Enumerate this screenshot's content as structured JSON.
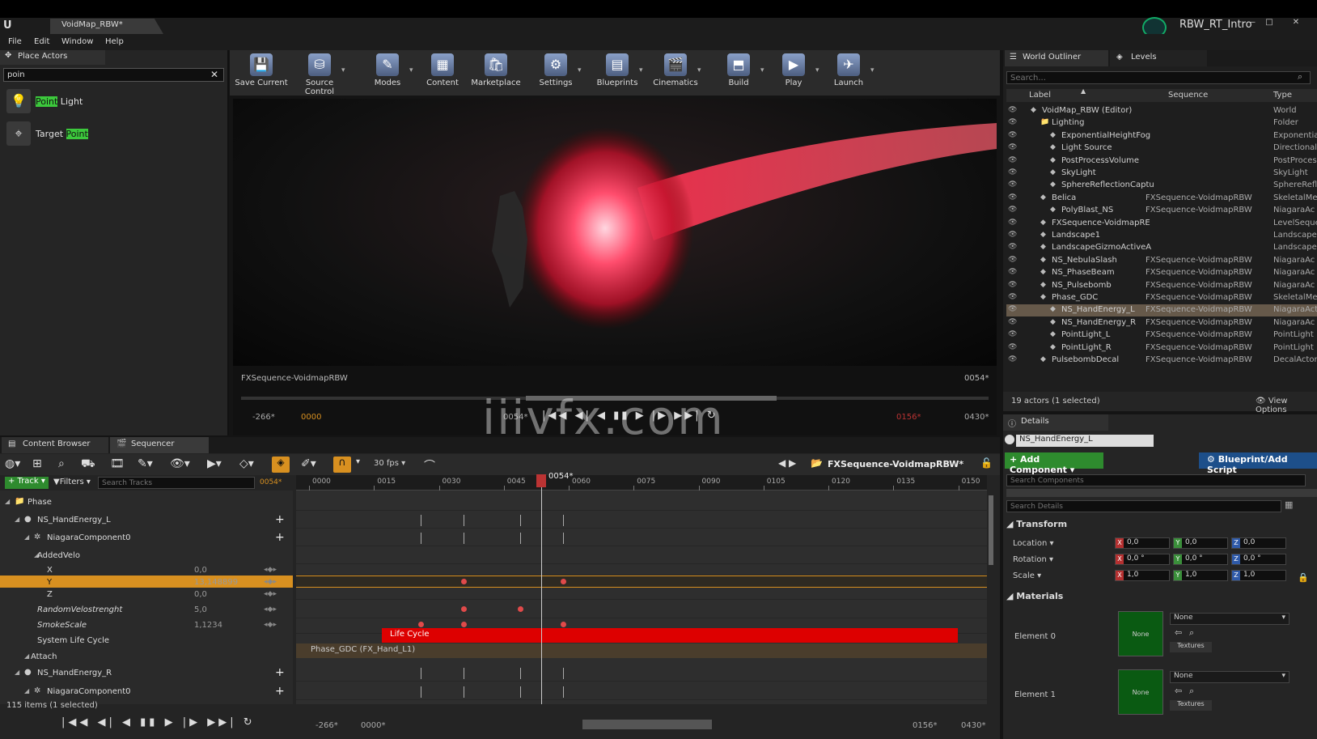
{
  "window": {
    "doc_tab": "VoidMap_RBW*",
    "project": "RBW_RT_Intro",
    "logo": "U"
  },
  "menu": [
    "File",
    "Edit",
    "Window",
    "Help"
  ],
  "place_actors": {
    "title": "Place Actors",
    "search_value": "poin",
    "items": [
      {
        "pre": "",
        "hl": "Point",
        "post": " Light",
        "icon": "bulb-icon"
      },
      {
        "pre": "Target ",
        "hl": "Point",
        "post": "",
        "icon": "target-icon"
      }
    ]
  },
  "toolbar": [
    {
      "label": "Save Current",
      "icon": "save-icon",
      "glyph": "💾"
    },
    {
      "label": "Source Control",
      "icon": "source-control-icon",
      "glyph": "⛁"
    },
    {
      "label": "Modes",
      "icon": "modes-icon",
      "glyph": "✎"
    },
    {
      "label": "Content",
      "icon": "content-icon",
      "glyph": "▦"
    },
    {
      "label": "Marketplace",
      "icon": "marketplace-icon",
      "glyph": "🛍"
    },
    {
      "label": "Settings",
      "icon": "settings-icon",
      "glyph": "⚙"
    },
    {
      "label": "Blueprints",
      "icon": "blueprints-icon",
      "glyph": "▤"
    },
    {
      "label": "Cinematics",
      "icon": "cinematics-icon",
      "glyph": "🎬"
    },
    {
      "label": "Build",
      "icon": "build-icon",
      "glyph": "⬒"
    },
    {
      "label": "Play",
      "icon": "play-icon",
      "glyph": "▶"
    },
    {
      "label": "Launch",
      "icon": "launch-icon",
      "glyph": "✈"
    }
  ],
  "viewport": {
    "sequence": "FXSequence-VoidmapRBW",
    "frame": "0054*",
    "range_start": "-266*",
    "start": "0000",
    "cur": "0054*",
    "end_red": "0156*",
    "end": "0430*",
    "watermark": "iiivfx.com"
  },
  "outliner": {
    "tabs": [
      "World Outliner",
      "Levels"
    ],
    "search_placeholder": "Search...",
    "columns": {
      "label": "Label",
      "sequence": "Sequence",
      "type": "Type"
    },
    "rows": [
      {
        "label": "VoidMap_RBW (Editor)",
        "seq": "",
        "type": "World",
        "indent": 0,
        "sel": false
      },
      {
        "label": "Lighting",
        "seq": "",
        "type": "Folder",
        "indent": 1,
        "sel": false
      },
      {
        "label": "ExponentialHeightFog",
        "seq": "",
        "type": "Exponentia",
        "indent": 2,
        "sel": false
      },
      {
        "label": "Light Source",
        "seq": "",
        "type": "Directional",
        "indent": 2,
        "sel": false
      },
      {
        "label": "PostProcessVolume",
        "seq": "",
        "type": "PostProces",
        "indent": 2,
        "sel": false
      },
      {
        "label": "SkyLight",
        "seq": "",
        "type": "SkyLight",
        "indent": 2,
        "sel": false
      },
      {
        "label": "SphereReflectionCaptu",
        "seq": "",
        "type": "SphereRefl",
        "indent": 2,
        "sel": false
      },
      {
        "label": "Belica",
        "seq": "FXSequence-VoidmapRBW",
        "type": "SkeletalMe",
        "indent": 1,
        "sel": false
      },
      {
        "label": "PolyBlast_NS",
        "seq": "FXSequence-VoidmapRBW",
        "type": "NiagaraAc",
        "indent": 2,
        "sel": false
      },
      {
        "label": "FXSequence-VoidmapRE",
        "seq": "",
        "type": "LevelSeque",
        "indent": 1,
        "sel": false
      },
      {
        "label": "Landscape1",
        "seq": "",
        "type": "Landscape",
        "indent": 1,
        "sel": false
      },
      {
        "label": "LandscapeGizmoActiveA",
        "seq": "",
        "type": "Landscape",
        "indent": 1,
        "sel": false
      },
      {
        "label": "NS_NebulaSlash",
        "seq": "FXSequence-VoidmapRBW",
        "type": "NiagaraAc",
        "indent": 1,
        "sel": false
      },
      {
        "label": "NS_PhaseBeam",
        "seq": "FXSequence-VoidmapRBW",
        "type": "NiagaraAc",
        "indent": 1,
        "sel": false
      },
      {
        "label": "NS_Pulsebomb",
        "seq": "FXSequence-VoidmapRBW",
        "type": "NiagaraAc",
        "indent": 1,
        "sel": false
      },
      {
        "label": "Phase_GDC",
        "seq": "FXSequence-VoidmapRBW",
        "type": "SkeletalMe",
        "indent": 1,
        "sel": false
      },
      {
        "label": "NS_HandEnergy_L",
        "seq": "FXSequence-VoidmapRBW",
        "type": "NiagaraAct",
        "indent": 2,
        "sel": true
      },
      {
        "label": "NS_HandEnergy_R",
        "seq": "FXSequence-VoidmapRBW",
        "type": "NiagaraAc",
        "indent": 2,
        "sel": false
      },
      {
        "label": "PointLight_L",
        "seq": "FXSequence-VoidmapRBW",
        "type": "PointLight",
        "indent": 2,
        "sel": false
      },
      {
        "label": "PointLight_R",
        "seq": "FXSequence-VoidmapRBW",
        "type": "PointLight",
        "indent": 2,
        "sel": false
      },
      {
        "label": "PulsebombDecal",
        "seq": "FXSequence-VoidmapRBW",
        "type": "DecalActor",
        "indent": 1,
        "sel": false
      }
    ],
    "footer": "19 actors (1 selected)",
    "view_options": "View Options"
  },
  "details": {
    "tab": "Details",
    "name": "NS_HandEnergy_L",
    "add_component": "+ Add Component",
    "blueprint": "Blueprint/Add Script",
    "search_components": "Search Components",
    "search_details": "Search Details",
    "transform_title": "Transform",
    "location_label": "Location",
    "rotation_label": "Rotation",
    "scale_label": "Scale",
    "location": [
      "0,0",
      "0,0",
      "0,0"
    ],
    "rotation": [
      "0,0 °",
      "0,0 °",
      "0,0 °"
    ],
    "scale": [
      "1,0",
      "1,0",
      "1,0"
    ],
    "materials_title": "Materials",
    "materials": [
      {
        "label": "Element 0",
        "thumb": "None",
        "value": "None",
        "textures": "Textures"
      },
      {
        "label": "Element 1",
        "thumb": "None",
        "value": "None",
        "textures": "Textures"
      }
    ]
  },
  "bottom_tabs": [
    "Content Browser",
    "Sequencer"
  ],
  "sequencer": {
    "fps": "30 fps",
    "title": "FXSequence-VoidmapRBW*",
    "track_label": "+ Track",
    "filters_label": "Filters",
    "search_placeholder": "Search Tracks",
    "current_frame": "0054*",
    "playhead_label": "0054*",
    "ticks": [
      "0000",
      "0015",
      "0030",
      "0045",
      "0060",
      "0075",
      "0090",
      "0105",
      "0120",
      "0135",
      "0150"
    ],
    "tracks": [
      {
        "label": "Phase",
        "indent": 0,
        "value": "",
        "plus": false,
        "sel": false,
        "italic": false
      },
      {
        "label": "NS_HandEnergy_L",
        "indent": 1,
        "value": "",
        "plus": true,
        "sel": false,
        "italic": false
      },
      {
        "label": "NiagaraComponent0",
        "indent": 2,
        "value": "",
        "plus": true,
        "sel": false,
        "italic": false
      },
      {
        "label": "AddedVelo",
        "indent": 3,
        "value": "",
        "plus": false,
        "sel": false,
        "italic": false
      },
      {
        "label": "X",
        "indent": 4,
        "value": "0,0",
        "plus": false,
        "sel": false,
        "italic": false
      },
      {
        "label": "Y",
        "indent": 4,
        "value": "13,148899",
        "plus": false,
        "sel": true,
        "italic": false
      },
      {
        "label": "Z",
        "indent": 4,
        "value": "0,0",
        "plus": false,
        "sel": false,
        "italic": false
      },
      {
        "label": "RandomVelostrenght",
        "indent": 3,
        "value": "5,0",
        "plus": false,
        "sel": false,
        "italic": true
      },
      {
        "label": "SmokeScale",
        "indent": 3,
        "value": "1,1234",
        "plus": false,
        "sel": false,
        "italic": true
      },
      {
        "label": "System Life Cycle",
        "indent": 3,
        "value": "",
        "plus": false,
        "sel": false,
        "italic": false
      },
      {
        "label": "Attach",
        "indent": 2,
        "value": "",
        "plus": false,
        "sel": false,
        "italic": false
      },
      {
        "label": "NS_HandEnergy_R",
        "indent": 1,
        "value": "",
        "plus": true,
        "sel": false,
        "italic": false
      },
      {
        "label": "NiagaraComponent0",
        "indent": 2,
        "value": "",
        "plus": true,
        "sel": false,
        "italic": false
      }
    ],
    "lifecycle_label": "Life Cycle",
    "attach_label": "Phase_GDC (FX_Hand_L1)",
    "items_count": "115 items (1 selected)",
    "foot_start": "-266*",
    "foot_zero": "0000*",
    "foot_end_red": "0156*",
    "foot_end": "0430*"
  },
  "colors": {
    "accent": "#d89020",
    "selection": "#66594a",
    "lifecycle": "#dd0000",
    "add_green": "#2e8b2e"
  }
}
